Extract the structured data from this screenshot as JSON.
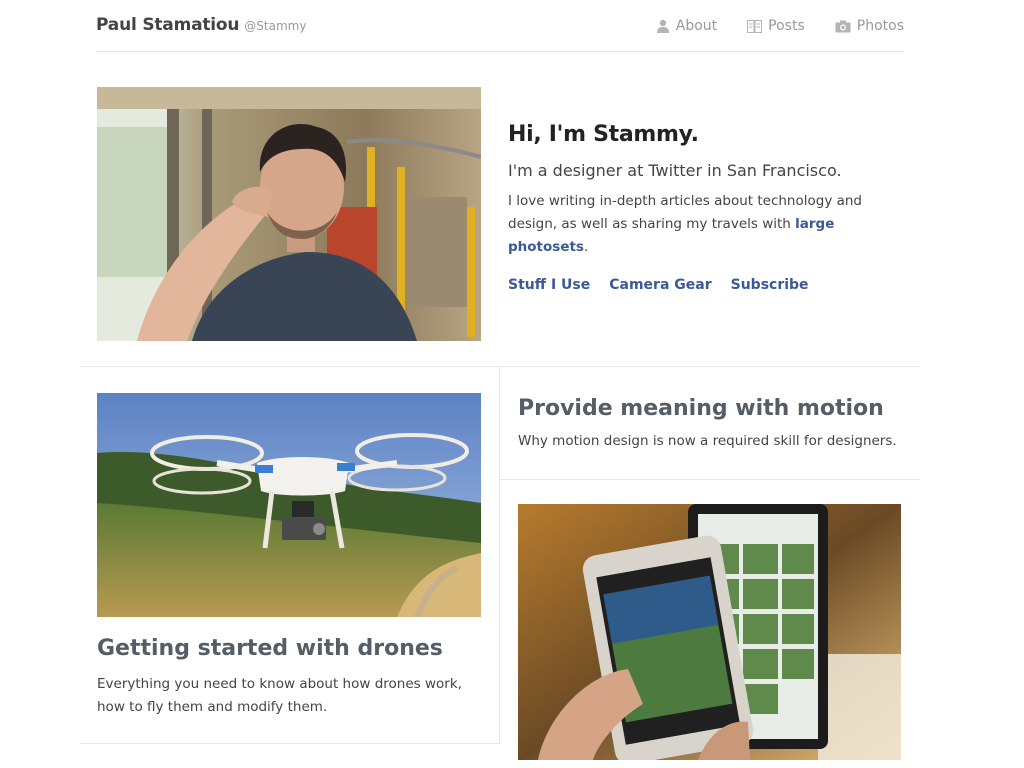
{
  "header": {
    "name": "Paul Stamatiou",
    "handle": "@Stammy",
    "nav": [
      {
        "label": "About",
        "icon": "person-icon"
      },
      {
        "label": "Posts",
        "icon": "book-icon"
      },
      {
        "label": "Photos",
        "icon": "camera-icon"
      }
    ]
  },
  "hero": {
    "title": "Hi, I'm Stammy.",
    "subtitle": "I'm a designer at Twitter in San Francisco.",
    "body_text": "I love writing in-depth articles about technology and design, as well as sharing my travels with",
    "body_link": "large photosets",
    "body_end": ".",
    "links": [
      "Stuff I Use",
      "Camera Gear",
      "Subscribe"
    ]
  },
  "articles": {
    "drones": {
      "title": "Getting started with drones",
      "description": "Everything you need to know about how drones work, how to fly them and modify them."
    },
    "motion": {
      "title": "Provide meaning with motion",
      "description": "Why motion design is now a required skill for designers."
    }
  }
}
